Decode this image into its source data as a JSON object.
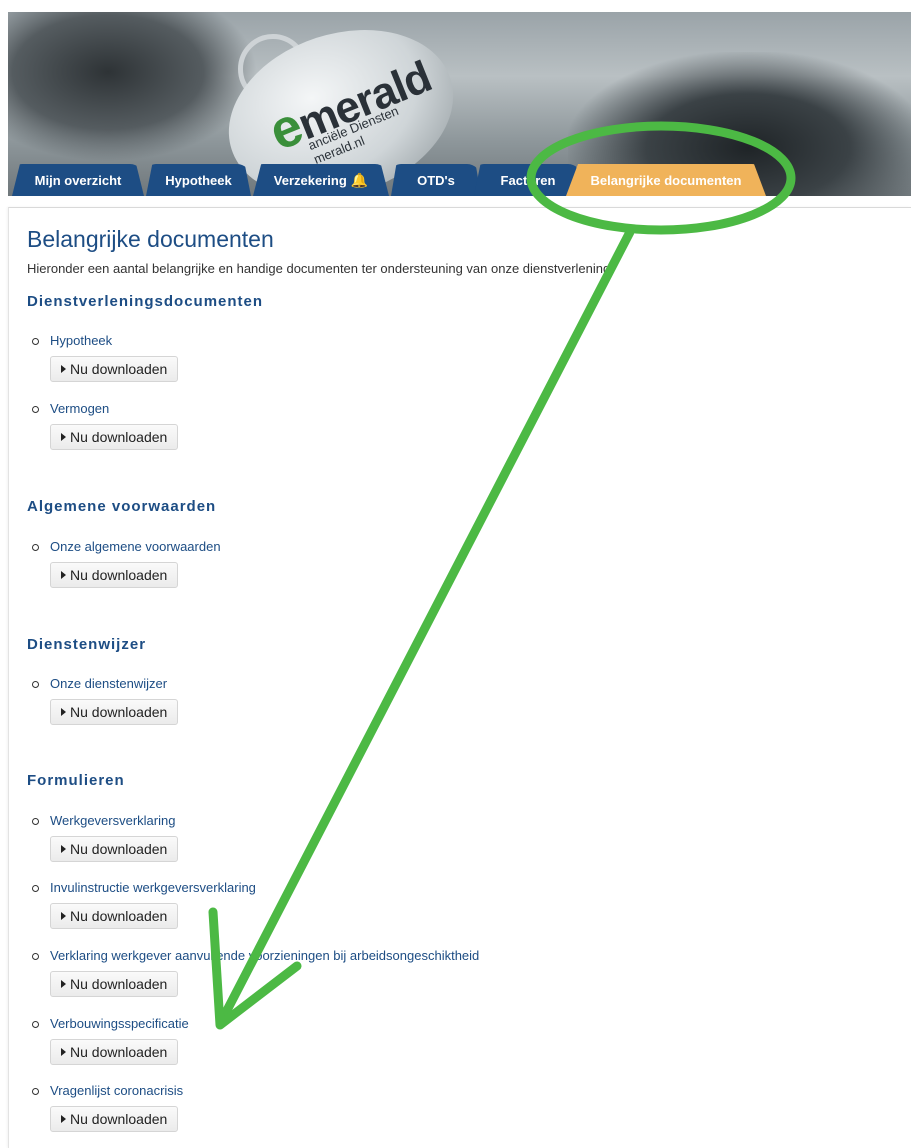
{
  "banner": {
    "logo_main": "merald",
    "logo_e": "e",
    "logo_sub": "anciële Diensten",
    "logo_url": "merald.nl"
  },
  "tabs": [
    {
      "label": "Mijn overzicht"
    },
    {
      "label": "Hypotheek"
    },
    {
      "label": "Verzekering",
      "badge": "!"
    },
    {
      "label": "OTD's"
    },
    {
      "label": "Facturen"
    },
    {
      "label": "Belangrijke documenten",
      "active": true
    }
  ],
  "page": {
    "title": "Belangrijke documenten",
    "intro": "Hieronder een aantal belangrijke en handige documenten ter ondersteuning van onze dienstverlening."
  },
  "download_label": "Nu downloaden",
  "sections": [
    {
      "title": "Dienstverleningsdocumenten",
      "items": [
        "Hypotheek",
        "Vermogen"
      ]
    },
    {
      "title": "Algemene voorwaarden",
      "items": [
        "Onze algemene voorwaarden"
      ]
    },
    {
      "title": "Dienstenwijzer",
      "items": [
        "Onze dienstenwijzer"
      ]
    },
    {
      "title": "Formulieren",
      "items": [
        "Werkgeversverklaring",
        "Invulinstructie werkgeversverklaring",
        "Verklaring werkgever aanvullende voorzieningen bij arbeidsongeschiktheid",
        "Verbouwingsspecificatie",
        "Vragenlijst coronacrisis"
      ]
    }
  ],
  "colors": {
    "tab": "#1d4d84",
    "tab_active": "#f0b35a",
    "heading": "#1d4d84",
    "annotation": "#4cb944"
  }
}
